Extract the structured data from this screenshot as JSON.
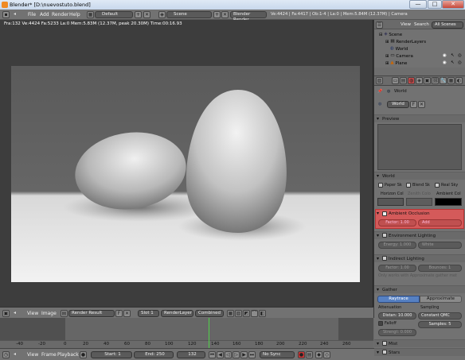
{
  "window": {
    "title": "Blender* [D:\\nuevostuto.blend]",
    "min": "—",
    "max": "□",
    "close": "✕"
  },
  "top_menu": {
    "items": [
      "File",
      "Add",
      "Render",
      "Help"
    ],
    "screen": "Default",
    "scene": "Scene",
    "engine": "Blender Render",
    "stats": "Ve:4424 | Fa:4417 | Ob:1-4 | La:0 | Mem:5.84M (12.37M) | Camera"
  },
  "viewport": {
    "info": "Fra:132  Ve:4424 Fa:5233 La:0 Mem:5.83M (12.37M, peak 20.30M) Time:00:16.93"
  },
  "image_header": {
    "view": "View",
    "image": "Image",
    "image_name": "Render Result",
    "f_label": "F",
    "slot": "Slot 1",
    "layer": "RenderLayer",
    "pass": "Combined"
  },
  "timeline": {
    "ticks": [
      "-40",
      "-20",
      "0",
      "20",
      "40",
      "60",
      "80",
      "100",
      "120",
      "140",
      "160",
      "180",
      "200",
      "220",
      "240",
      "260"
    ],
    "current_frame_mark": 132
  },
  "bottom_header": {
    "view": "View",
    "frame": "Frame",
    "playback": "Playback",
    "start": "Start: 1",
    "end": "End: 250",
    "current": "132",
    "sync": "No Sync"
  },
  "outliner": {
    "view": "View",
    "search": "Search",
    "all_scenes": "All Scenes",
    "items": [
      "Scene",
      "RenderLayers",
      "World",
      "Camera",
      "Plane"
    ]
  },
  "properties": {
    "world_context": "World",
    "world_block": "World",
    "world_f": "F",
    "panels": {
      "preview": "Preview",
      "world": "World",
      "ao": "Ambient Occlusion",
      "env": "Environment Lighting",
      "indirect": "Indirect Lighting",
      "gather": "Gather",
      "mist": "Mist",
      "stars": "Stars"
    },
    "world_opts": [
      "Paper Sk",
      "Blend Sk",
      "Real Sky"
    ],
    "colors": {
      "horizon": "Horizon Col",
      "zenith": "Zenith Colo",
      "ambient": "Ambient Col"
    },
    "ao_factor": "Factor: 1.00",
    "ao_mode": "Add",
    "env_energy": "Energy: 1.000",
    "env_color": "White",
    "ind_factor": "Factor: 1.00",
    "ind_bounces": "Bounces: 1",
    "ind_note": "Only works with Approximate gather met",
    "gather_raytrace": "Raytrace",
    "gather_approx": "Approximate",
    "attenuation": "Attenuation",
    "sampling": "Sampling",
    "distance": "Distan: 10.000",
    "sampling_method": "Constant QMC",
    "falloff": "Falloff",
    "samples": "Samples: 5",
    "strength": "Strengt: 0.000"
  }
}
